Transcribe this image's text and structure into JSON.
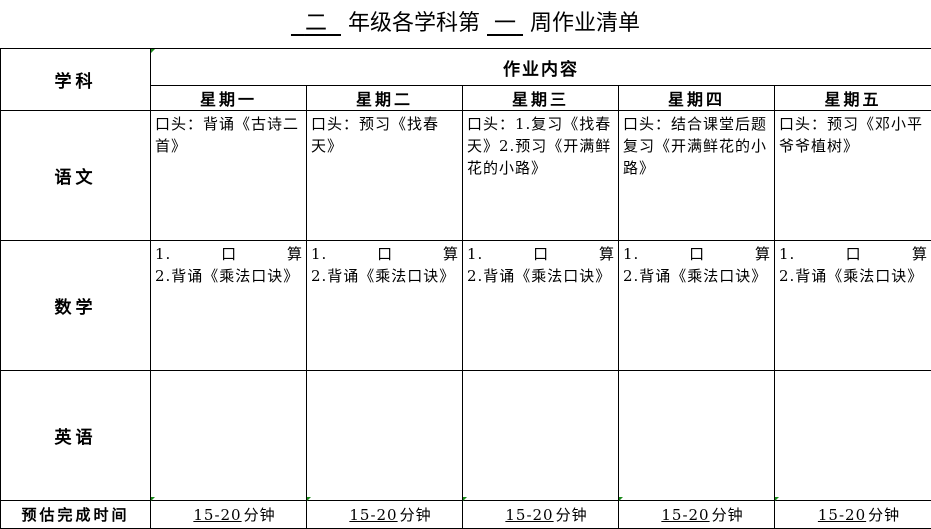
{
  "title": {
    "grade": "二",
    "text1": "年级各学科第",
    "week": "一",
    "text2": "周作业清单"
  },
  "header": {
    "subject_label": "学科",
    "content_label": "作业内容",
    "days": [
      "星期一",
      "星期二",
      "星期三",
      "星期四",
      "星期五"
    ]
  },
  "rows": {
    "chinese": {
      "label": "语文",
      "cells": [
        "口头：背诵《古诗二首》",
        "口头：预习《找春天》",
        "口头：1.复习《找春天》2.预习《开满鲜花的小路》",
        "口头：结合课堂后题复习《开满鲜花的小路》",
        "口头：预习《邓小平爷爷植树》"
      ]
    },
    "math": {
      "label": "数学",
      "line1": [
        "1.",
        "口",
        "算"
      ],
      "line2": "2.背诵《乘法口诀》"
    },
    "english": {
      "label": "英语",
      "cells": [
        "",
        "",
        "",
        "",
        ""
      ]
    }
  },
  "time": {
    "label": "预估完成时间",
    "value": "15-20",
    "unit": "分钟"
  },
  "colors": {
    "corner_mark": "#1a8a1a"
  }
}
